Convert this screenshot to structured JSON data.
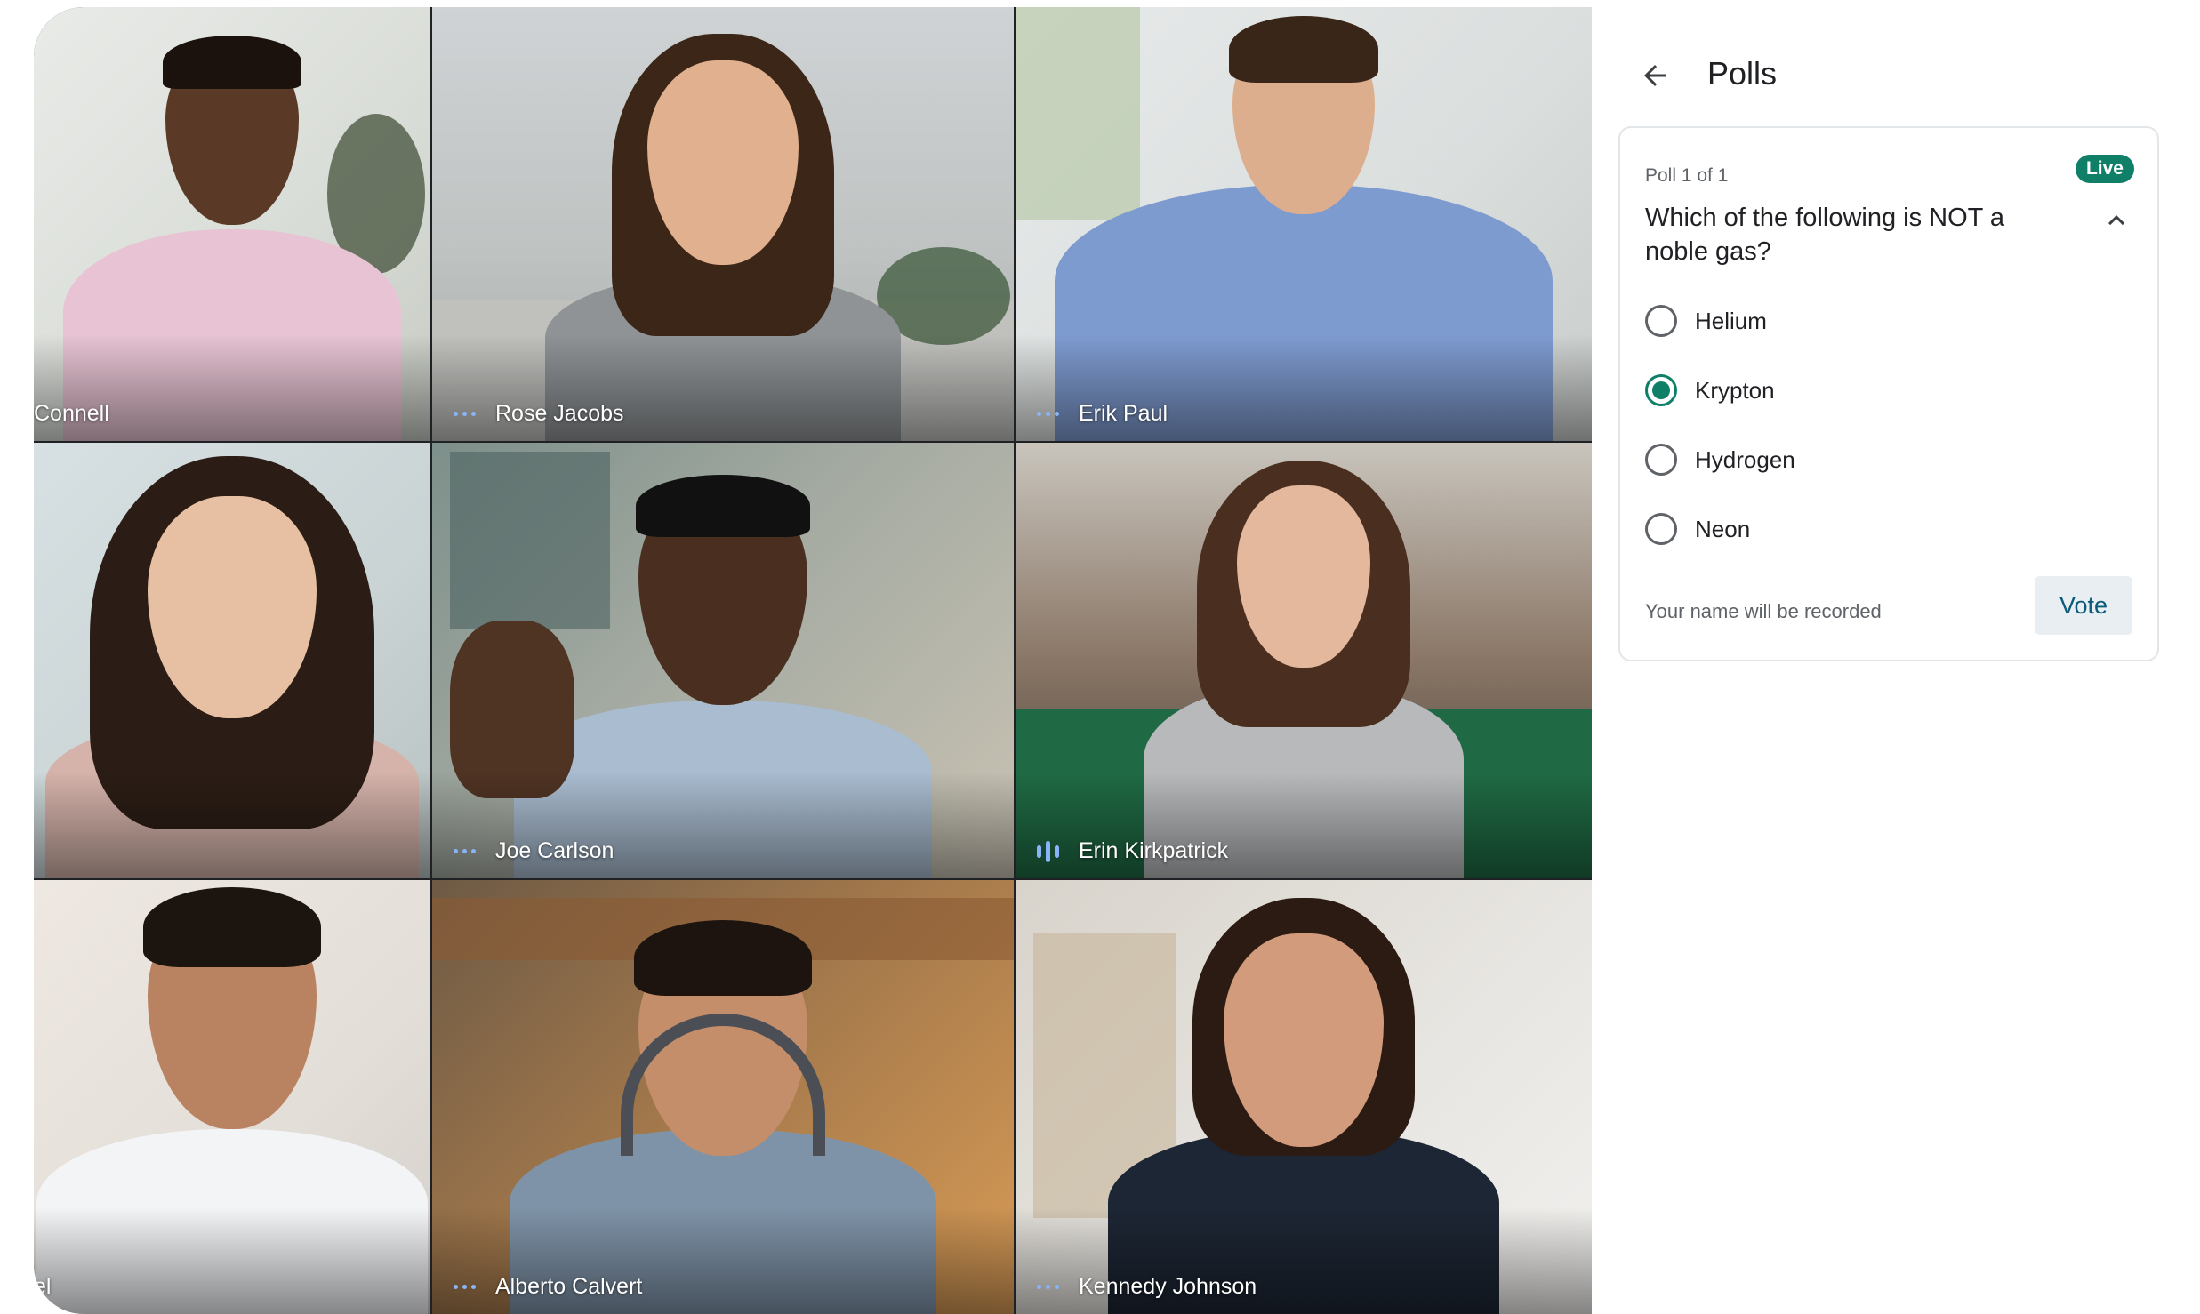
{
  "participants": [
    {
      "name": "Connell",
      "indicator": "none"
    },
    {
      "name": "Rose Jacobs",
      "indicator": "dots-icon"
    },
    {
      "name": "Erik Paul",
      "indicator": "dots-icon"
    },
    {
      "name": "",
      "indicator": "none"
    },
    {
      "name": "Joe Carlson",
      "indicator": "dots-icon"
    },
    {
      "name": "Erin Kirkpatrick",
      "indicator": "speaking-bars-icon"
    },
    {
      "name": "el",
      "indicator": "none"
    },
    {
      "name": "Alberto Calvert",
      "indicator": "dots-icon"
    },
    {
      "name": "Kennedy Johnson",
      "indicator": "dots-icon"
    }
  ],
  "panel": {
    "title": "Polls",
    "back_icon": "arrow-left-icon"
  },
  "poll": {
    "count": "Poll 1 of 1",
    "badge": "Live",
    "question": "Which of the following is NOT a noble gas?",
    "collapse_icon": "chevron-up-icon",
    "options": [
      {
        "label": "Helium",
        "selected": false
      },
      {
        "label": "Krypton",
        "selected": true
      },
      {
        "label": "Hydrogen",
        "selected": false
      },
      {
        "label": "Neon",
        "selected": false
      }
    ],
    "note": "Your name will be recorded",
    "vote_label": "Vote"
  },
  "colors": {
    "accent": "#0f7f68",
    "vote_text": "#0b5a78",
    "indicator": "#8ab4f8"
  }
}
